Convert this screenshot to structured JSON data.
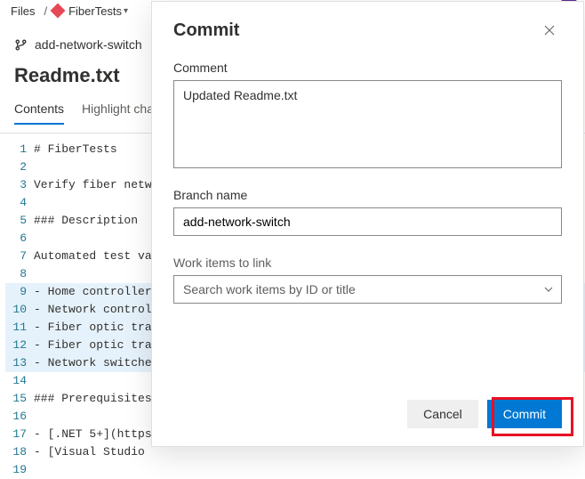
{
  "breadcrumb": {
    "files": "Files",
    "repo": "FiberTests"
  },
  "branch_bar": {
    "name": "add-network-switch"
  },
  "page": {
    "title": "Readme.txt"
  },
  "tabs": {
    "contents": "Contents",
    "highlight": "Highlight cha"
  },
  "code": {
    "lines": [
      "# FiberTests",
      "",
      "Verify fiber netw",
      "",
      "### Description",
      "",
      "Automated test va",
      "",
      "- Home controller",
      "- Network control",
      "- Fiber optic tra",
      "- Fiber optic tra",
      "- Network switche",
      "",
      "### Prerequisites",
      "",
      "- [.NET 5+](https",
      "- [Visual Studio ",
      ""
    ]
  },
  "modal": {
    "title": "Commit",
    "comment_label": "Comment",
    "comment_value": "Updated Readme.txt",
    "branch_label": "Branch name",
    "branch_value": "add-network-switch",
    "workitems_label": "Work items to link",
    "workitems_placeholder": "Search work items by ID or title",
    "cancel": "Cancel",
    "commit": "Commit"
  }
}
